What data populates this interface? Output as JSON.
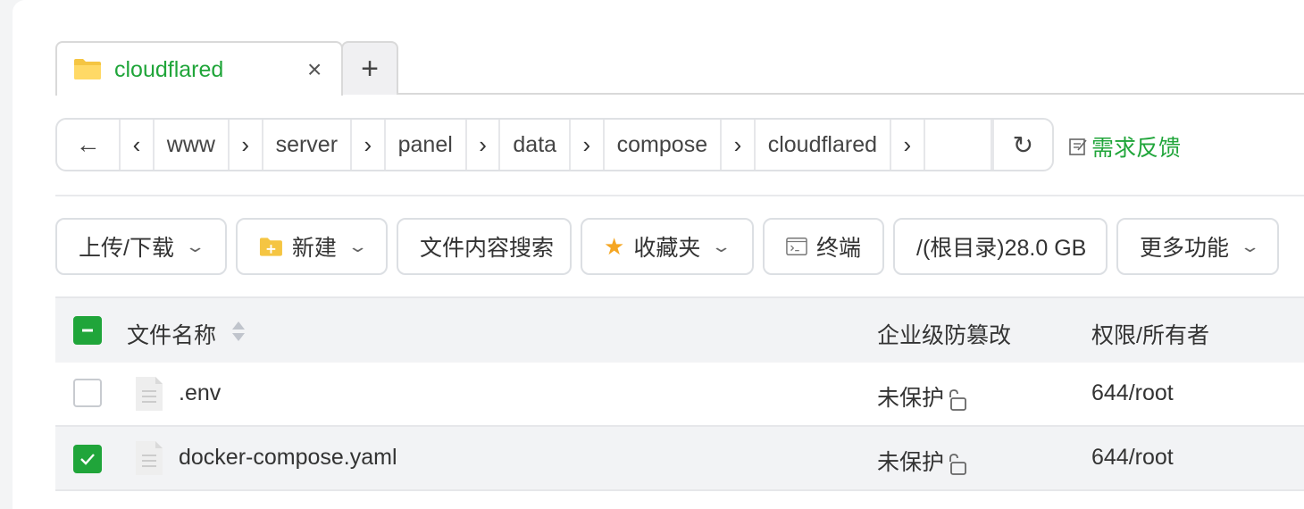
{
  "tabs": {
    "active_title": "cloudflared",
    "close_glyph": "×",
    "add_glyph": "+"
  },
  "path": {
    "back_glyph": "←",
    "segments": [
      "www",
      "server",
      "panel",
      "data",
      "compose",
      "cloudflared"
    ],
    "refresh_glyph": "↻"
  },
  "feedback": {
    "label": "需求反馈",
    "icon": "edit-icon"
  },
  "toolbar": {
    "upload_download": "上传/下载",
    "new": "新建",
    "content_search": "文件内容搜索",
    "favorites": "收藏夹",
    "terminal": "终端",
    "disk": "/(根目录)28.0 GB",
    "more": "更多功能"
  },
  "table": {
    "headers": {
      "name": "文件名称",
      "protection": "企业级防篡改",
      "permission": "权限/所有者"
    },
    "rows": [
      {
        "name": ".env",
        "protection": "未保护",
        "permission": "644/root",
        "checked": false
      },
      {
        "name": "docker-compose.yaml",
        "protection": "未保护",
        "permission": "644/root",
        "checked": true
      }
    ]
  },
  "colors": {
    "accent": "#20a53a",
    "folder": "#f5c542",
    "star": "#f5a623"
  }
}
